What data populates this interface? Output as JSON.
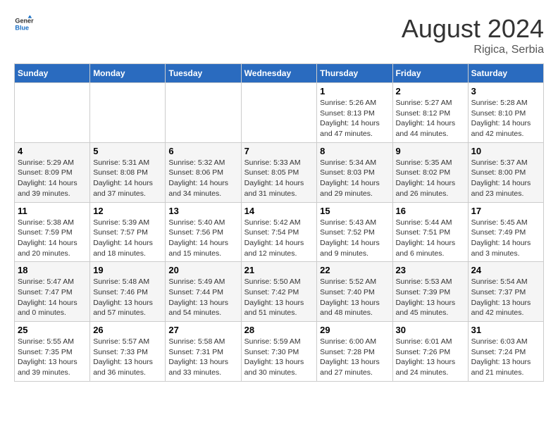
{
  "header": {
    "logo_general": "General",
    "logo_blue": "Blue",
    "month_year": "August 2024",
    "location": "Rigica, Serbia"
  },
  "calendar": {
    "days_of_week": [
      "Sunday",
      "Monday",
      "Tuesday",
      "Wednesday",
      "Thursday",
      "Friday",
      "Saturday"
    ],
    "weeks": [
      [
        {
          "day": "",
          "info": ""
        },
        {
          "day": "",
          "info": ""
        },
        {
          "day": "",
          "info": ""
        },
        {
          "day": "",
          "info": ""
        },
        {
          "day": "1",
          "info": "Sunrise: 5:26 AM\nSunset: 8:13 PM\nDaylight: 14 hours\nand 47 minutes."
        },
        {
          "day": "2",
          "info": "Sunrise: 5:27 AM\nSunset: 8:12 PM\nDaylight: 14 hours\nand 44 minutes."
        },
        {
          "day": "3",
          "info": "Sunrise: 5:28 AM\nSunset: 8:10 PM\nDaylight: 14 hours\nand 42 minutes."
        }
      ],
      [
        {
          "day": "4",
          "info": "Sunrise: 5:29 AM\nSunset: 8:09 PM\nDaylight: 14 hours\nand 39 minutes."
        },
        {
          "day": "5",
          "info": "Sunrise: 5:31 AM\nSunset: 8:08 PM\nDaylight: 14 hours\nand 37 minutes."
        },
        {
          "day": "6",
          "info": "Sunrise: 5:32 AM\nSunset: 8:06 PM\nDaylight: 14 hours\nand 34 minutes."
        },
        {
          "day": "7",
          "info": "Sunrise: 5:33 AM\nSunset: 8:05 PM\nDaylight: 14 hours\nand 31 minutes."
        },
        {
          "day": "8",
          "info": "Sunrise: 5:34 AM\nSunset: 8:03 PM\nDaylight: 14 hours\nand 29 minutes."
        },
        {
          "day": "9",
          "info": "Sunrise: 5:35 AM\nSunset: 8:02 PM\nDaylight: 14 hours\nand 26 minutes."
        },
        {
          "day": "10",
          "info": "Sunrise: 5:37 AM\nSunset: 8:00 PM\nDaylight: 14 hours\nand 23 minutes."
        }
      ],
      [
        {
          "day": "11",
          "info": "Sunrise: 5:38 AM\nSunset: 7:59 PM\nDaylight: 14 hours\nand 20 minutes."
        },
        {
          "day": "12",
          "info": "Sunrise: 5:39 AM\nSunset: 7:57 PM\nDaylight: 14 hours\nand 18 minutes."
        },
        {
          "day": "13",
          "info": "Sunrise: 5:40 AM\nSunset: 7:56 PM\nDaylight: 14 hours\nand 15 minutes."
        },
        {
          "day": "14",
          "info": "Sunrise: 5:42 AM\nSunset: 7:54 PM\nDaylight: 14 hours\nand 12 minutes."
        },
        {
          "day": "15",
          "info": "Sunrise: 5:43 AM\nSunset: 7:52 PM\nDaylight: 14 hours\nand 9 minutes."
        },
        {
          "day": "16",
          "info": "Sunrise: 5:44 AM\nSunset: 7:51 PM\nDaylight: 14 hours\nand 6 minutes."
        },
        {
          "day": "17",
          "info": "Sunrise: 5:45 AM\nSunset: 7:49 PM\nDaylight: 14 hours\nand 3 minutes."
        }
      ],
      [
        {
          "day": "18",
          "info": "Sunrise: 5:47 AM\nSunset: 7:47 PM\nDaylight: 14 hours\nand 0 minutes."
        },
        {
          "day": "19",
          "info": "Sunrise: 5:48 AM\nSunset: 7:46 PM\nDaylight: 13 hours\nand 57 minutes."
        },
        {
          "day": "20",
          "info": "Sunrise: 5:49 AM\nSunset: 7:44 PM\nDaylight: 13 hours\nand 54 minutes."
        },
        {
          "day": "21",
          "info": "Sunrise: 5:50 AM\nSunset: 7:42 PM\nDaylight: 13 hours\nand 51 minutes."
        },
        {
          "day": "22",
          "info": "Sunrise: 5:52 AM\nSunset: 7:40 PM\nDaylight: 13 hours\nand 48 minutes."
        },
        {
          "day": "23",
          "info": "Sunrise: 5:53 AM\nSunset: 7:39 PM\nDaylight: 13 hours\nand 45 minutes."
        },
        {
          "day": "24",
          "info": "Sunrise: 5:54 AM\nSunset: 7:37 PM\nDaylight: 13 hours\nand 42 minutes."
        }
      ],
      [
        {
          "day": "25",
          "info": "Sunrise: 5:55 AM\nSunset: 7:35 PM\nDaylight: 13 hours\nand 39 minutes."
        },
        {
          "day": "26",
          "info": "Sunrise: 5:57 AM\nSunset: 7:33 PM\nDaylight: 13 hours\nand 36 minutes."
        },
        {
          "day": "27",
          "info": "Sunrise: 5:58 AM\nSunset: 7:31 PM\nDaylight: 13 hours\nand 33 minutes."
        },
        {
          "day": "28",
          "info": "Sunrise: 5:59 AM\nSunset: 7:30 PM\nDaylight: 13 hours\nand 30 minutes."
        },
        {
          "day": "29",
          "info": "Sunrise: 6:00 AM\nSunset: 7:28 PM\nDaylight: 13 hours\nand 27 minutes."
        },
        {
          "day": "30",
          "info": "Sunrise: 6:01 AM\nSunset: 7:26 PM\nDaylight: 13 hours\nand 24 minutes."
        },
        {
          "day": "31",
          "info": "Sunrise: 6:03 AM\nSunset: 7:24 PM\nDaylight: 13 hours\nand 21 minutes."
        }
      ]
    ]
  }
}
